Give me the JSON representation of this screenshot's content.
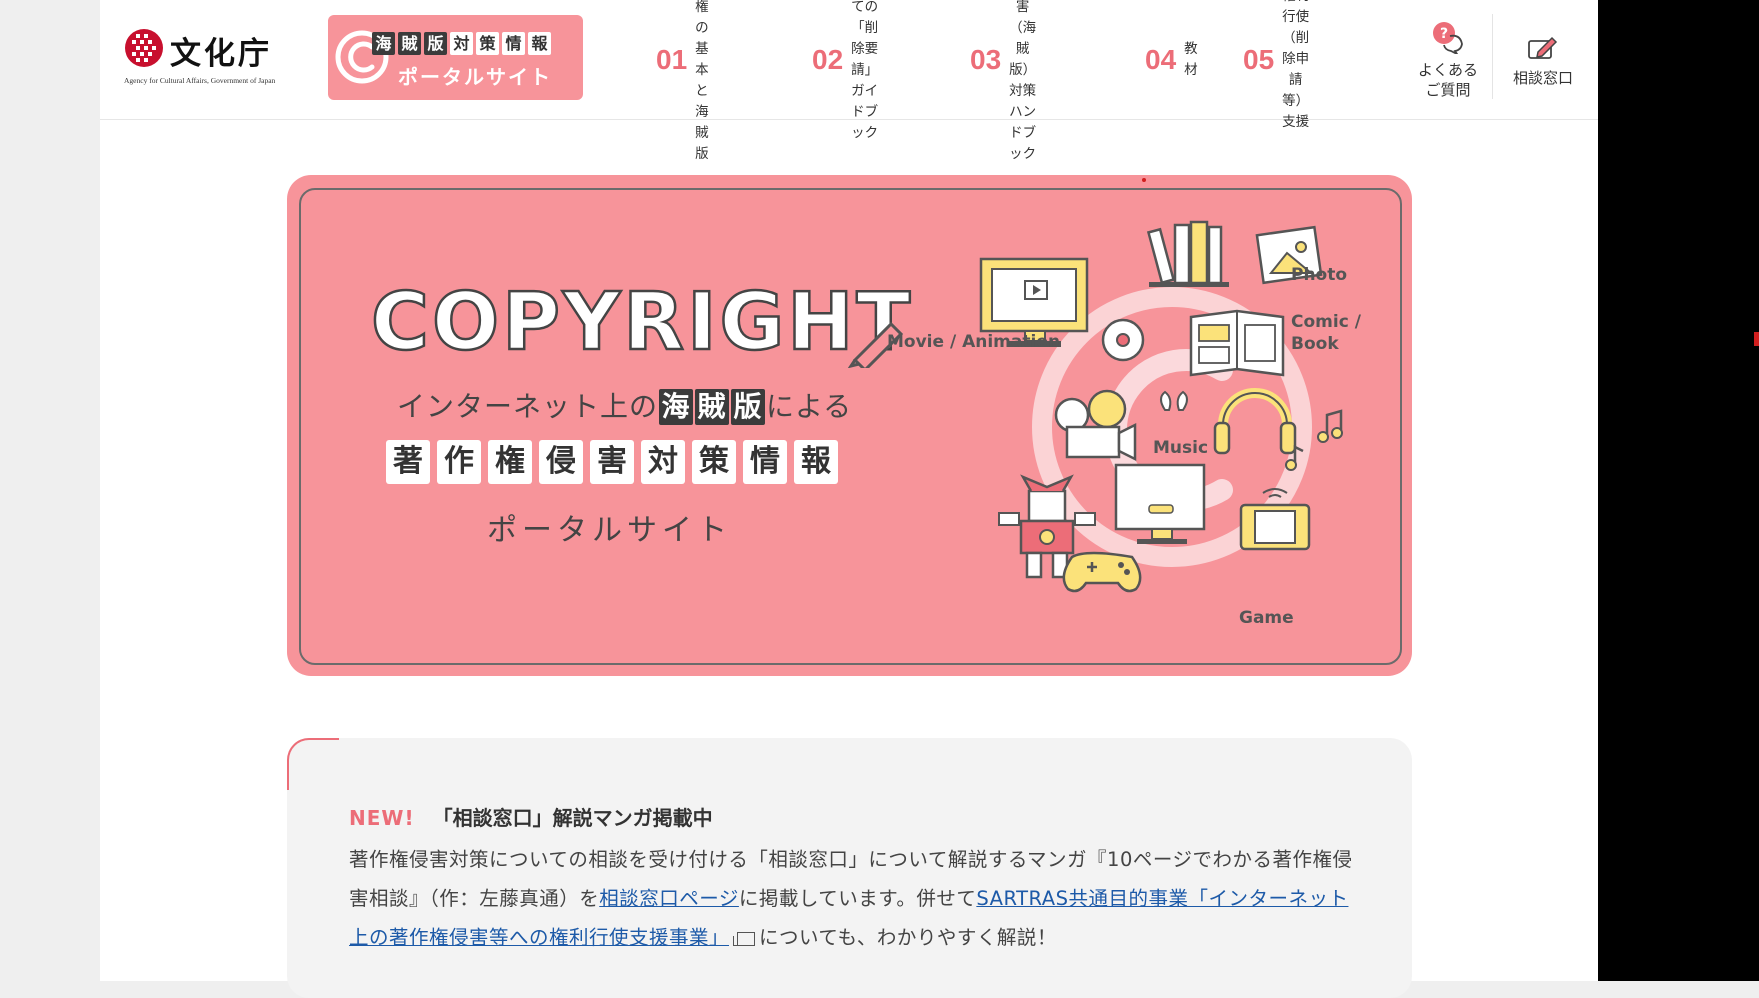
{
  "header": {
    "logo": {
      "name": "文化庁",
      "sub": "Agency for Cultural Affairs, Government of Japan"
    },
    "portal": {
      "tags": [
        "海",
        "賊",
        "版",
        "対",
        "策",
        "情",
        "報"
      ],
      "name": "ポータルサイト"
    },
    "nav": [
      {
        "num": "01",
        "lines": [
          "著作権の",
          "基本と海賊版"
        ]
      },
      {
        "num": "02",
        "lines": [
          "初めての",
          "「削除要請」",
          "ガイドブック"
        ]
      },
      {
        "num": "03",
        "lines": [
          "著作権侵害",
          "（海賊版）対策",
          "ハンドブック"
        ]
      },
      {
        "num": "04",
        "lines": [
          "教材"
        ]
      },
      {
        "num": "05",
        "lines": [
          "権利行使",
          "（削除申請等）",
          "支援"
        ]
      }
    ],
    "faq": {
      "lines": [
        "よくある",
        "ご質問"
      ]
    },
    "consult": {
      "label": "相談窓口"
    }
  },
  "hero": {
    "word": "COPYRIGHT",
    "line1_pre": "インターネット上の",
    "line1_boxes": [
      "海",
      "賊",
      "版"
    ],
    "line1_post": "による",
    "line2": [
      "著",
      "作",
      "権",
      "侵",
      "害",
      "対",
      "策",
      "情",
      "報"
    ],
    "line3": "ポータルサイト",
    "labels": {
      "movie": "Movie / Animation",
      "photo": "Photo",
      "comic": "Comic /\nBook",
      "music": "Music",
      "game": "Game"
    }
  },
  "news": {
    "badge": "NEW!",
    "title": "「相談窓口」解説マンガ掲載中",
    "body_1": "著作権侵害対策についての相談を受け付ける「相談窓口」について解説するマンガ『10ページでわかる著作権侵害相談』（作：左藤真通）を",
    "link_1": "相談窓口ページ",
    "body_2": "に掲載しています。併せて",
    "link_2": "SARTRAS共通目的事業「インターネット上の著作権侵害等への権利行使支援事業」",
    "body_3": "についても、わかりやすく解説！"
  }
}
